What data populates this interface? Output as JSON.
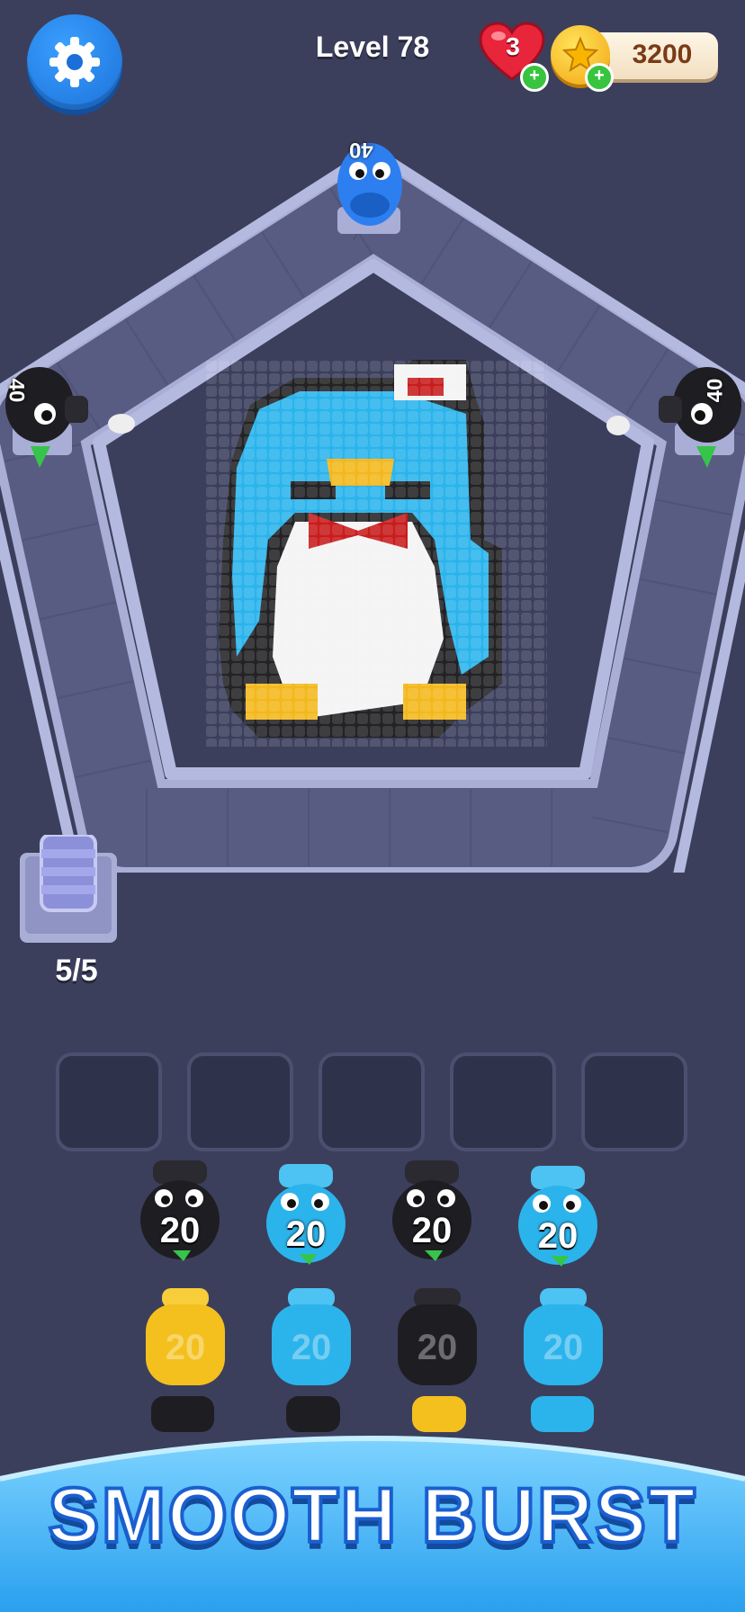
{
  "hud": {
    "level_label": "Level 78",
    "lives": "3",
    "coins": "3200",
    "settings_icon": "gear-icon",
    "heart_icon": "heart-icon",
    "coin_icon": "star-coin-icon",
    "plus_icon": "plus-icon"
  },
  "shooters": [
    {
      "color": "#2d7ff0",
      "count": "40",
      "name": "blue-shooter"
    },
    {
      "color": "#1e1e22",
      "count": "40",
      "name": "black-shooter-left"
    },
    {
      "color": "#1e1e22",
      "count": "40",
      "name": "black-shooter-right"
    }
  ],
  "stack": {
    "count": "5/5"
  },
  "queue_rows": [
    [
      {
        "color": "#1e1e22",
        "label": "20"
      },
      {
        "color": "#2bb4ec",
        "label": "20"
      },
      {
        "color": "#1e1e22",
        "label": "20"
      },
      {
        "color": "#2bb4ec",
        "label": "20"
      }
    ],
    [
      {
        "color": "#f3c01e",
        "label": "20"
      },
      {
        "color": "#2bb4ec",
        "label": "20"
      },
      {
        "color": "#1e1e22",
        "label": "20"
      },
      {
        "color": "#2bb4ec",
        "label": "20"
      }
    ]
  ],
  "banner": {
    "title": "SMOOTH BURST"
  },
  "colors": {
    "background": "#3b3f5c",
    "track": "#585c82",
    "accent_blue": "#1b6fd8",
    "pixel_cyan": "#2bb4ec",
    "pixel_black": "#222",
    "pixel_white": "#f4f4f4",
    "pixel_yellow": "#f3b81e",
    "pixel_red": "#c81d1d"
  }
}
